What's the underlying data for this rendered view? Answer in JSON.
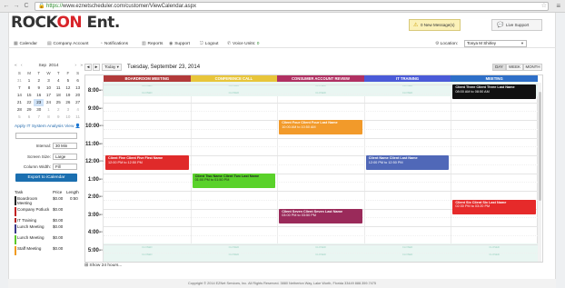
{
  "browser": {
    "url_scheme": "https://",
    "url_rest": "www.eznetscheduler.com/customer/ViewCalendar.aspx",
    "back": "←",
    "forward": "→",
    "reload": "C"
  },
  "brand": {
    "logo_part1": "ROCK",
    "logo_part2": "ON",
    "logo_part3": " Ent.",
    "accent": "#d8242a"
  },
  "header": {
    "messages": "0 New Message(s)",
    "live_support": "Live Support"
  },
  "toolbar": {
    "items": [
      "Calendar",
      "Company Account",
      "Notifications",
      "Reports",
      "Support",
      "Logout",
      "Voice Units: "
    ],
    "voice_units": "0",
    "location_label": "Location:",
    "location_value": "Tonya M Shirley"
  },
  "mini_calendar": {
    "month": "Sep",
    "year": "2014",
    "dow": [
      "S",
      "M",
      "T",
      "W",
      "T",
      "F",
      "S"
    ],
    "days": [
      "31",
      "1",
      "2",
      "3",
      "4",
      "5",
      "6",
      "7",
      "8",
      "9",
      "10",
      "11",
      "12",
      "13",
      "14",
      "15",
      "16",
      "17",
      "18",
      "19",
      "20",
      "21",
      "22",
      "23",
      "24",
      "25",
      "26",
      "27",
      "28",
      "29",
      "30",
      "1",
      "2",
      "3",
      "4",
      "5",
      "6",
      "7",
      "8",
      "9",
      "10",
      "11"
    ],
    "today_index": 23
  },
  "sidebar": {
    "apply_text": "Apply IT System Analysis View",
    "interval_label": "Interval:",
    "interval_value": "30 Min",
    "screen_size_label": "Screen Size:",
    "screen_size_value": "Large",
    "column_width_label": "Column Width:",
    "column_width_value": "Fill",
    "export_label": "Export to iCalendar"
  },
  "legend": {
    "headers": [
      "Task",
      "Price",
      "Length"
    ],
    "rows": [
      {
        "task": "Boardroom Meeting",
        "price": "$0.00",
        "length": "0:50",
        "color": "#222222"
      },
      {
        "task": "Company Potluck",
        "price": "$0.00",
        "length": "",
        "color": "#c02020"
      },
      {
        "task": "IT Training",
        "price": "$0.00",
        "length": "",
        "color": "#b22222"
      },
      {
        "task": "Lunch Meeting",
        "price": "$0.00",
        "length": "",
        "color": "#3a3a8a"
      },
      {
        "task": "Lunch Meeting",
        "price": "$0.00",
        "length": "",
        "color": "#5cc82a"
      },
      {
        "task": "Staff Meeting",
        "price": "$0.00",
        "length": "",
        "color": "#f09a20"
      }
    ]
  },
  "calendar": {
    "today_label": "Today",
    "date_title": "Tuesday, September 23, 2014",
    "views": [
      "DAY",
      "WEEK",
      "MONTH"
    ],
    "prev": "◄",
    "next": "►",
    "columns": [
      {
        "name": "BOARDROOM MEETING",
        "color": "#b23a3a"
      },
      {
        "name": "CONFERENCE CALL",
        "color": "#e8c53a"
      },
      {
        "name": "CONSUMER ACCOUNT REVIEW",
        "color": "#b03062"
      },
      {
        "name": "IT TRAINING",
        "color": "#4a5ad8"
      },
      {
        "name": "MEETING",
        "color": "#2e6fc8"
      }
    ],
    "times": [
      {
        "hour": "8:00",
        "ampm": "am"
      },
      {
        "hour": "9:00",
        "ampm": "am"
      },
      {
        "hour": "10:00",
        "ampm": "am"
      },
      {
        "hour": "11:00",
        "ampm": "am"
      },
      {
        "hour": "12:00",
        "ampm": "pm"
      },
      {
        "hour": "1:00",
        "ampm": "pm"
      },
      {
        "hour": "2:00",
        "ampm": "pm"
      },
      {
        "hour": "3:00",
        "ampm": "pm"
      },
      {
        "hour": "4:00",
        "ampm": "pm"
      },
      {
        "hour": "5:00",
        "ampm": "pm"
      }
    ],
    "closed_label": "CLOSED",
    "events": [
      {
        "col": 4,
        "start": "8:00",
        "end": "8:50",
        "title": "Client Three Client Three Last Name",
        "time": "08:00 AM to 08:50 AM",
        "bg": "#111111",
        "dark": false
      },
      {
        "col": 2,
        "start": "10:00",
        "end": "10:50",
        "title": "Client Four Client Four Last Name",
        "time": "10:00 AM to 10:50 AM",
        "bg": "#f29a2a",
        "dark": false
      },
      {
        "col": 0,
        "start": "12:00",
        "end": "12:50",
        "title": "Client Five Client Five First Name",
        "time": "12:00 PM to 12:50 PM",
        "bg": "#e02a2a",
        "dark": false
      },
      {
        "col": 3,
        "start": "12:00",
        "end": "12:50",
        "title": "Client Name Client Last Name",
        "time": "12:00 PM to 12:50 PM",
        "bg": "#5068b8",
        "dark": false
      },
      {
        "col": 1,
        "start": "13:00",
        "end": "13:50",
        "title": "Client Two Name Client Two Last Name",
        "time": "01:00 PM to 01:50 PM",
        "bg": "#5ad22a",
        "dark": true
      },
      {
        "col": 4,
        "start": "14:30",
        "end": "15:20",
        "title": "Client Six Client Six Last Name",
        "time": "02:30 PM to 03:20 PM",
        "bg": "#e62a2a",
        "dark": false
      },
      {
        "col": 2,
        "start": "15:00",
        "end": "15:50",
        "title": "Client Seven Client Seven Last Name",
        "time": "03:00 PM to 03:50 PM",
        "bg": "#9a2a5a",
        "dark": false
      }
    ],
    "show24": "Show 24 hours..."
  },
  "footer": {
    "text": "Copyright © 2014 EZNet Services, Inc. All Rights Reserved.     3880 Netherton Way, Lake Worth, Florida 33449     888.359.7475"
  }
}
